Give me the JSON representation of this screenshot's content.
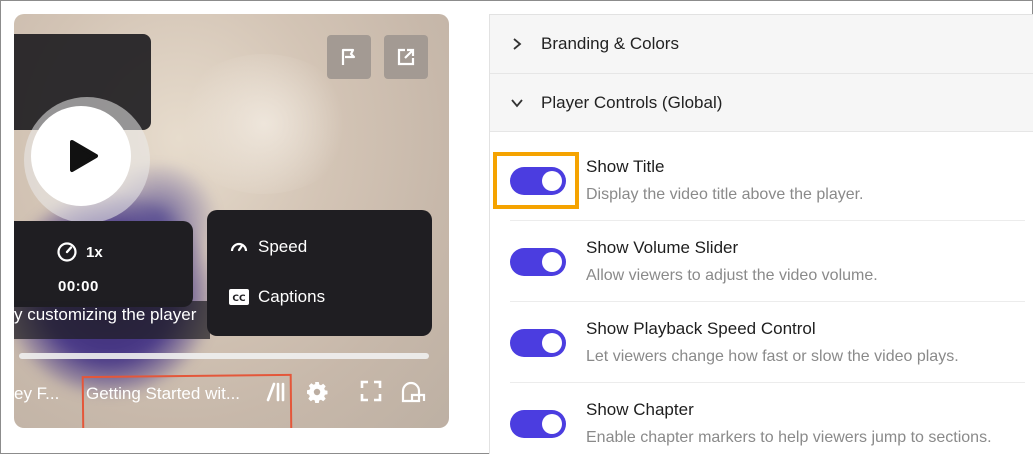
{
  "player": {
    "speed_value": "1x",
    "time_value": "00:00",
    "menu": {
      "speed_label": "Speed",
      "captions_label": "Captions"
    },
    "subtitle": "y customizing the player",
    "prev_chapter": "ey F...",
    "current_title": "Getting Started wit...",
    "icons": [
      "play-icon",
      "flag-icon",
      "external-link-icon",
      "speedometer-icon",
      "cc-icon",
      "chapters-icon",
      "gear-icon",
      "fullscreen-icon",
      "pip-icon"
    ]
  },
  "settings": {
    "sections": [
      {
        "label": "Branding & Colors",
        "expanded": false
      },
      {
        "label": "Player Controls (Global)",
        "expanded": true
      }
    ],
    "rows": [
      {
        "title": "Show Title",
        "description": "Display the video title above the player.",
        "enabled": true
      },
      {
        "title": "Show Volume Slider",
        "description": "Allow viewers to adjust the video volume.",
        "enabled": true
      },
      {
        "title": "Show Playback Speed Control",
        "description": "Let viewers change how fast or slow the video plays.",
        "enabled": true
      },
      {
        "title": "Show Chapter",
        "description": "Enable chapter markers to help viewers jump to sections.",
        "enabled": true
      }
    ],
    "accent_color": "#4b3de0",
    "highlight_color": "#f5a300",
    "annotation_color": "#e4573a"
  }
}
